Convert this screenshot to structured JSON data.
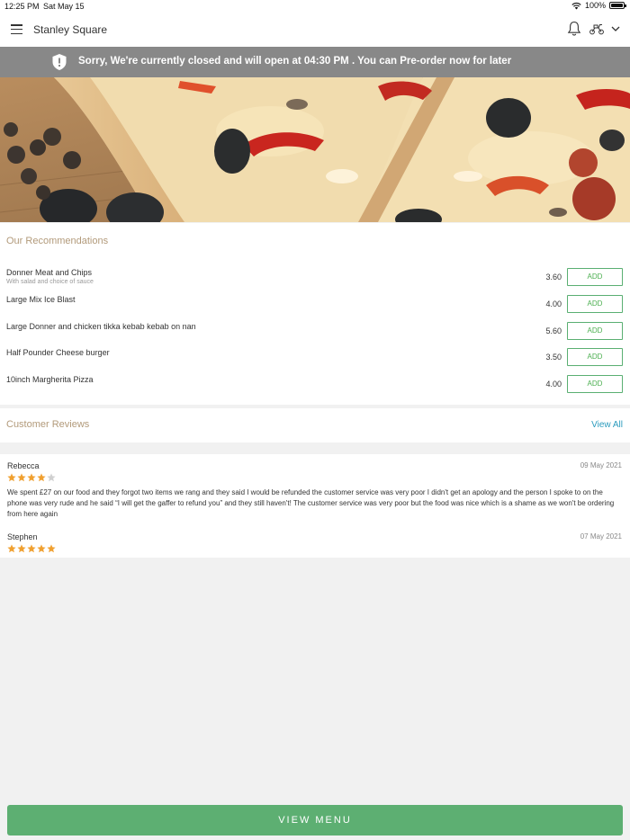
{
  "status_bar": {
    "time": "12:25 PM",
    "date": "Sat May 15",
    "battery": "100%"
  },
  "header": {
    "title": "Stanley Square"
  },
  "banner": {
    "message": "Sorry, We're currently closed and will open at 04:30 PM . You can Pre-order now for later"
  },
  "recommendations": {
    "title": "Our Recommendations",
    "items": [
      {
        "name": "Donner Meat and Chips",
        "description": "With salad and choice of sauce",
        "price": "3.60",
        "button": "ADD"
      },
      {
        "name": "Large Mix Ice Blast",
        "description": "",
        "price": "4.00",
        "button": "ADD"
      },
      {
        "name": "Large Donner and chicken tikka kebab kebab on nan",
        "description": "",
        "price": "5.60",
        "button": "ADD"
      },
      {
        "name": "Half Pounder Cheese burger",
        "description": "",
        "price": "3.50",
        "button": "ADD"
      },
      {
        "name": "10inch Margherita Pizza",
        "description": "",
        "price": "4.00",
        "button": "ADD"
      }
    ]
  },
  "reviews": {
    "title": "Customer Reviews",
    "view_all": "View All",
    "items": [
      {
        "author": "Rebecca",
        "date": "09 May 2021",
        "rating": 4,
        "text": "We spent £27 on our food and they forgot two items we rang and they said I would be refunded the customer service was very poor I didn't get an apology and the person I spoke to on the phone was very rude and he said “I will get the gaffer to refund you” and they still haven't! The customer service was very poor but the food was nice which is a shame as we won't be ordering from here again"
      },
      {
        "author": "Stephen",
        "date": "07 May 2021",
        "rating": 5,
        "text": ""
      }
    ]
  },
  "footer": {
    "view_menu": "VIEW MENU"
  },
  "colors": {
    "accent_green": "#5daf72",
    "banner_gray": "#888888",
    "section_title": "#b29a7a",
    "link_blue": "#2b9bbd",
    "star_orange": "#f0a030",
    "star_empty": "#d0d0d0"
  },
  "icons": [
    "menu-icon",
    "bell-icon",
    "scooter-icon",
    "chevron-down-icon",
    "shield-alert-icon",
    "wifi-icon",
    "battery-icon",
    "star-icon"
  ]
}
